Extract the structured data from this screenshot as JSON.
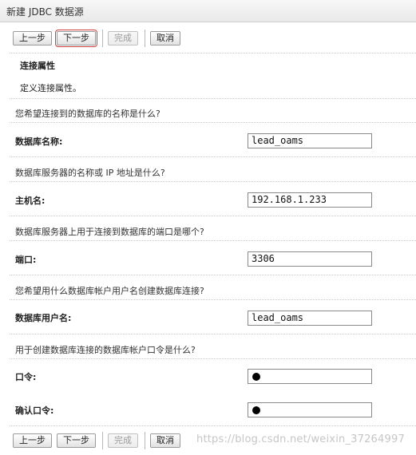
{
  "window": {
    "title": "新建 JDBC 数据源"
  },
  "buttons": {
    "back": "上一步",
    "next": "下一步",
    "finish": "完成",
    "cancel": "取消"
  },
  "section": {
    "title": "连接属性",
    "description": "定义连接属性。"
  },
  "fields": [
    {
      "question": "您希望连接到的数据库的名称是什么?",
      "label": "数据库名称:",
      "value": "lead_oams"
    },
    {
      "question": "数据库服务器的名称或 IP 地址是什么?",
      "label": "主机名:",
      "value": "192.168.1.233"
    },
    {
      "question": "数据库服务器上用于连接到数据库的端口是哪个?",
      "label": "端口:",
      "value": "3306"
    },
    {
      "question": "您希望用什么数据库帐户用户名创建数据库连接?",
      "label": "数据库用户名:",
      "value": "lead_oams"
    }
  ],
  "password": {
    "question": "用于创建数据库连接的数据库帐户口令是什么?",
    "label": "口令:",
    "confirm_label": "确认口令:"
  },
  "watermark": "https://blog.csdn.net/weixin_37264997"
}
